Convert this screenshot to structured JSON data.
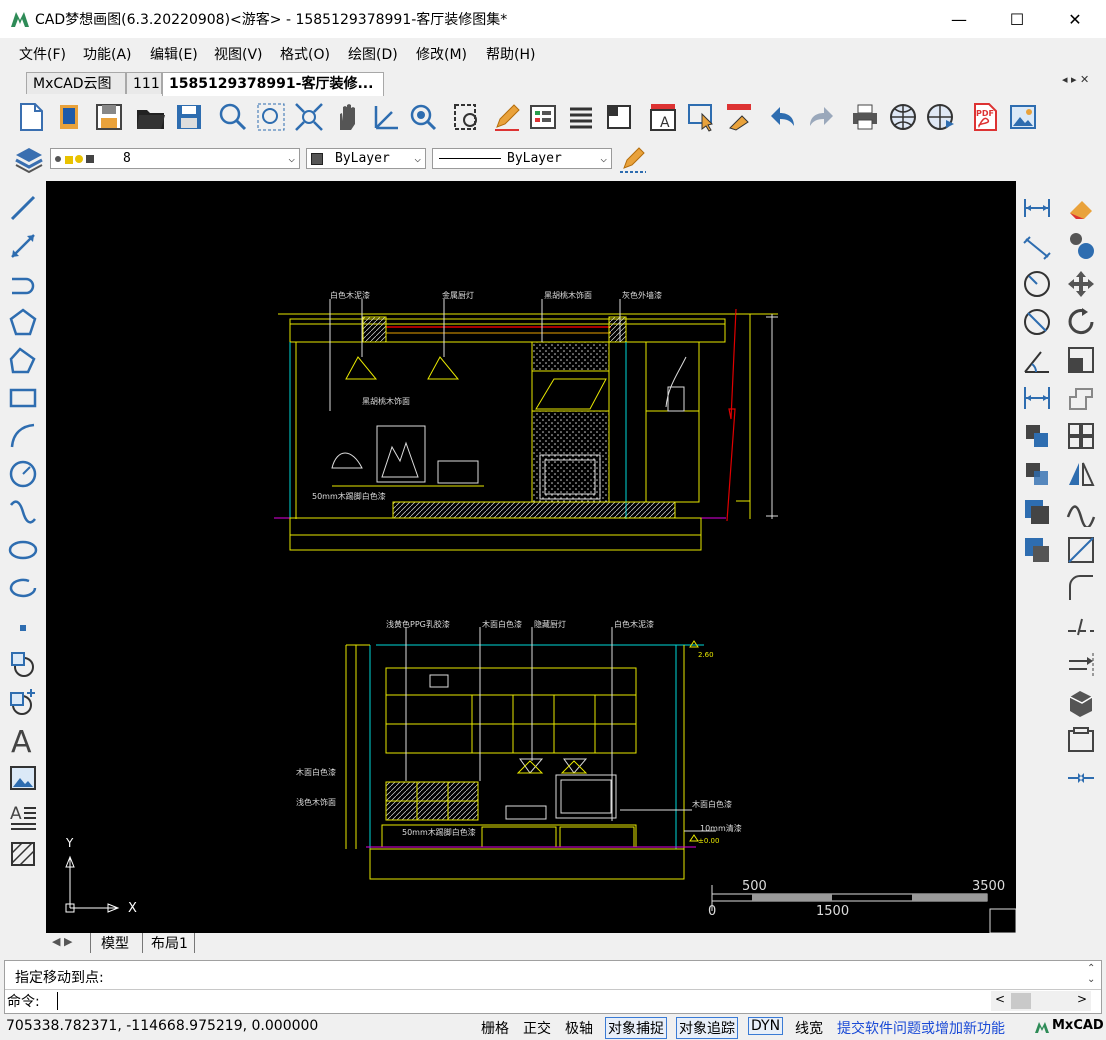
{
  "window": {
    "title": "CAD梦想画图(6.3.20220908)<游客> - 1585129378991-客厅装修图集*",
    "minimize_glyph": "—",
    "maximize_glyph": "☐",
    "close_glyph": "✕"
  },
  "menu": {
    "items": [
      {
        "label": "文件(F)"
      },
      {
        "label": "功能(A)"
      },
      {
        "label": "编辑(E)"
      },
      {
        "label": "视图(V)"
      },
      {
        "label": "格式(O)"
      },
      {
        "label": "绘图(D)"
      },
      {
        "label": "修改(M)"
      },
      {
        "label": "帮助(H)"
      }
    ]
  },
  "tabs": {
    "items": [
      {
        "label": "MxCAD云图"
      },
      {
        "label": "111"
      },
      {
        "label": "1585129378991-客厅装修..."
      }
    ],
    "nav_glyphs": "◂ ▸ ✕"
  },
  "layer_bar": {
    "layer_name": "8",
    "color_value": "ByLayer",
    "linetype_value": "ByLayer"
  },
  "drawing": {
    "upper_labels": [
      "白色木泥漆",
      "金属厨灯",
      "黑胡桃木饰面",
      "灰色外墙漆",
      "黑胡桃木饰面",
      "50mm木踢脚白色漆"
    ],
    "lower_labels": [
      "浅黄色PPG乳胶漆",
      "木面白色漆",
      "隐藏厨灯",
      "白色木泥漆",
      "木面白色漆",
      "浅色木饰面",
      "50mm木踢脚白色漆",
      "木面白色漆",
      "10mm清漆",
      "2.60",
      "±0.00"
    ],
    "scale_labels": [
      "500",
      "3500",
      "0",
      "1500"
    ],
    "ucs_x": "X",
    "ucs_y": "Y"
  },
  "layout_tabs": {
    "items": [
      {
        "label": "模型"
      },
      {
        "label": "布局1"
      }
    ]
  },
  "command": {
    "history_line": "指定移动到点:",
    "prompt_label": "命令:",
    "input_value": ""
  },
  "status": {
    "coordinates": "705338.782371,  -114668.975219,  0.000000",
    "toggles": [
      {
        "label": "栅格"
      },
      {
        "label": "正交"
      },
      {
        "label": "极轴"
      },
      {
        "label": "对象捕捉"
      },
      {
        "label": "对象追踪"
      },
      {
        "label": "DYN"
      },
      {
        "label": "线宽"
      }
    ],
    "feedback_link": "提交软件问题或增加新功能",
    "brand": "MxCAD"
  },
  "colors": {
    "yellow_line": "#e8e800",
    "cyan_line": "#00d8d8",
    "magenta_line": "#e000e0",
    "red_line": "#e00000",
    "link_blue": "#1a4ad6"
  }
}
